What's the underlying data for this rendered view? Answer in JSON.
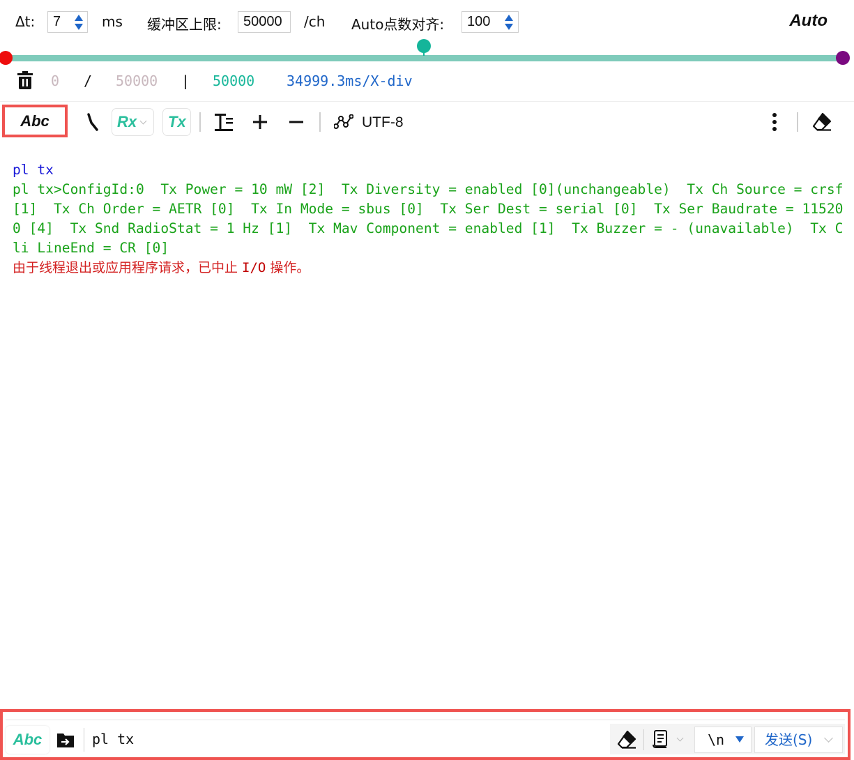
{
  "params": {
    "dt_label": "Δt:",
    "dt_value": "7",
    "dt_unit": "ms",
    "buffer_label": "缓冲区上限:",
    "buffer_value": "50000",
    "buffer_unit": "/ch",
    "auto_align_label": "Auto点数对齐:",
    "auto_align_value": "100",
    "auto_label": "Auto"
  },
  "slider": {
    "left_color": "#ee0d0d",
    "mid_color": "#14b59a",
    "right_color": "#7a0a80",
    "track_color": "#7fcbbb",
    "mid_position": 0.5
  },
  "info": {
    "start": "0",
    "slash": "/",
    "total": "50000",
    "bar": "|",
    "count": "50000",
    "scale": "34999.3ms/X-div"
  },
  "toolbar": {
    "abc_label": "Abc",
    "rx_label": "Rx",
    "tx_label": "Tx",
    "encoding_label": "UTF-8"
  },
  "terminal": {
    "command_line": "pl tx",
    "output_line": "pl tx>ConfigId:0  Tx Power = 10 mW [2]  Tx Diversity = enabled [0](unchangeable)  Tx Ch Source = crsf [1]  Tx Ch Order = AETR [0]  Tx In Mode = sbus [0]  Tx Ser Dest = serial [0]  Tx Ser Baudrate = 115200 [4]  Tx Snd RadioStat = 1 Hz [1]  Tx Mav Component = enabled [1]  Tx Buzzer = - (unavailable)  Tx Cli LineEnd = CR [0]",
    "error_prefix": "由于线程退出或应用程序请求，已中止 ",
    "error_io": "I/O",
    "error_suffix": " 操作。"
  },
  "input_bar": {
    "abc_label": "Abc",
    "command_value": "pl tx",
    "line_ending": "\\n",
    "send_label": "发送(S)"
  }
}
